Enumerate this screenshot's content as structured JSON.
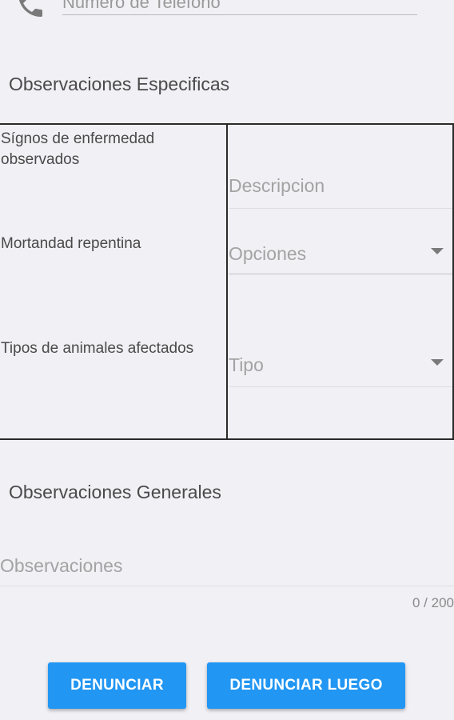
{
  "contact": {
    "phone_placeholder": "Numero de Telefono",
    "phone_icon": "phone-icon"
  },
  "specific": {
    "title": "Observaciones Especificas",
    "rows": [
      {
        "label": "Sígnos de enfermedad observados",
        "field": "Descripcion"
      },
      {
        "label": "Mortandad repentina",
        "field": "Opciones"
      },
      {
        "label": "Tipos de animales afectados",
        "field": "Tipo"
      }
    ]
  },
  "general": {
    "title": "Observaciones Generales",
    "placeholder": "Observaciones",
    "counter": "0 / 200"
  },
  "actions": {
    "report_label": "DENUNCIAR",
    "report_later_label": "DENUNCIAR LUEGO"
  },
  "colors": {
    "background": "#f0f0f5",
    "accent": "#2196f3",
    "text": "#4a4a4a",
    "placeholder": "#a3a3a3"
  }
}
